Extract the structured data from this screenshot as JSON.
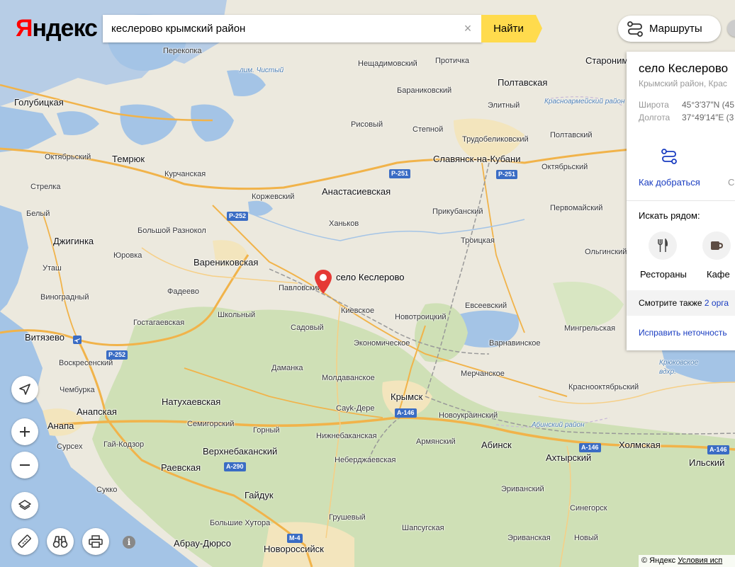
{
  "logo": {
    "text": "Яндекс",
    "first": "Я",
    "rest": "ндекс"
  },
  "search": {
    "value": "кеслерово крымский район",
    "clear": "×",
    "button": "Найти"
  },
  "routes_button": "Маршруты",
  "card": {
    "title": "село Кеслерово",
    "subtitle": "Крымский район, Крас",
    "lat_label": "Широта",
    "lat_value": "45°3′37″N (45",
    "lon_label": "Долгота",
    "lon_value": "37°49′14″E (3",
    "how_to_get": "Как добраться",
    "edge_letter": "С",
    "nearby_label": "Искать рядом:",
    "categories": [
      "Рестораны",
      "Кафе"
    ],
    "see_also_prefix": "Смотрите также",
    "see_also_link": "2 орга",
    "fix": "Исправить неточность"
  },
  "marker_label": "село Кеслерово",
  "copyright": {
    "text": "© Яндекс",
    "terms": "Условия исп"
  },
  "colors": {
    "land": "#e9e6da",
    "forest": "#cfe0b6",
    "water": "#a4c4e6",
    "road": "#f1b34a",
    "shield": "#3a6cc4",
    "accent": "#ffdb4d",
    "link": "#1a3dc1",
    "marker": "#e53935"
  },
  "places": [
    {
      "name": "Перекопка"
    },
    {
      "name": "лим. Чистый"
    },
    {
      "name": "Нещадимовский"
    },
    {
      "name": "Протичка"
    },
    {
      "name": "Староним"
    },
    {
      "name": "Голубицкая"
    },
    {
      "name": "Бараниковский"
    },
    {
      "name": "Полтавская"
    },
    {
      "name": "Красноармейский район"
    },
    {
      "name": "Элитный"
    },
    {
      "name": "Рисовый"
    },
    {
      "name": "Степной"
    },
    {
      "name": "Трудобеликовский"
    },
    {
      "name": "Полтавский"
    },
    {
      "name": "Октябрьский"
    },
    {
      "name": "Темрюк"
    },
    {
      "name": "Курчанская"
    },
    {
      "name": "Славянск-на-Кубани"
    },
    {
      "name": "Октябрьский"
    },
    {
      "name": "Стрелка"
    },
    {
      "name": "Коржевский"
    },
    {
      "name": "Анастасиевская"
    },
    {
      "name": "Белый"
    },
    {
      "name": "Прикубанский"
    },
    {
      "name": "Первомайский"
    },
    {
      "name": "Ханьков"
    },
    {
      "name": "Большой Разнокол"
    },
    {
      "name": "Джигинка"
    },
    {
      "name": "Троицкая"
    },
    {
      "name": "Юровка"
    },
    {
      "name": "Ольгинский"
    },
    {
      "name": "Варениковская"
    },
    {
      "name": "Уташ"
    },
    {
      "name": "Фадеево"
    },
    {
      "name": "Павловский"
    },
    {
      "name": "Виноградный"
    },
    {
      "name": "Киевское"
    },
    {
      "name": "Евсеевский"
    },
    {
      "name": "Школьный"
    },
    {
      "name": "Новотроицкий"
    },
    {
      "name": "Гостагаевская"
    },
    {
      "name": "Садовый"
    },
    {
      "name": "Мингрельская"
    },
    {
      "name": "Витязево"
    },
    {
      "name": "Варнавинское"
    },
    {
      "name": "Экономическое"
    },
    {
      "name": "Воскресенский"
    },
    {
      "name": "Крюковское вдхр."
    },
    {
      "name": "Даманка"
    },
    {
      "name": "Мерчанское"
    },
    {
      "name": "Молдаванское"
    },
    {
      "name": "Чембурка"
    },
    {
      "name": "Натухаевская"
    },
    {
      "name": "Красноокт­ябрьский"
    },
    {
      "name": "Крымск"
    },
    {
      "name": "Анапская"
    },
    {
      "name": "Сауk-Дере"
    },
    {
      "name": "Анапа"
    },
    {
      "name": "Семигорский"
    },
    {
      "name": "Новоукраинский"
    },
    {
      "name": "Абинский район"
    },
    {
      "name": "Горный"
    },
    {
      "name": "Нижнебаканская"
    },
    {
      "name": "Суpсех"
    },
    {
      "name": "Гай-Кодзор"
    },
    {
      "name": "Армянский"
    },
    {
      "name": "Абинск"
    },
    {
      "name": "Холмская"
    },
    {
      "name": "Верхнебаканский"
    },
    {
      "name": "Ахтырский"
    },
    {
      "name": "Ильский"
    },
    {
      "name": "Раевская"
    },
    {
      "name": "Неберджаевская"
    },
    {
      "name": "Сукко"
    },
    {
      "name": "Эриванский"
    },
    {
      "name": "Гайдук"
    },
    {
      "name": "Синегорск"
    },
    {
      "name": "Большие Хутора"
    },
    {
      "name": "Грушевый"
    },
    {
      "name": "Шапсугская"
    },
    {
      "name": "Абрау-Дюрсо"
    },
    {
      "name": "Новороссийск"
    },
    {
      "name": "Эриванская"
    },
    {
      "name": "Новый"
    }
  ],
  "shields": [
    "P-251",
    "P-251",
    "P-252",
    "P-252",
    "A-146",
    "A-146",
    "A-146",
    "A-290",
    "M-4"
  ]
}
